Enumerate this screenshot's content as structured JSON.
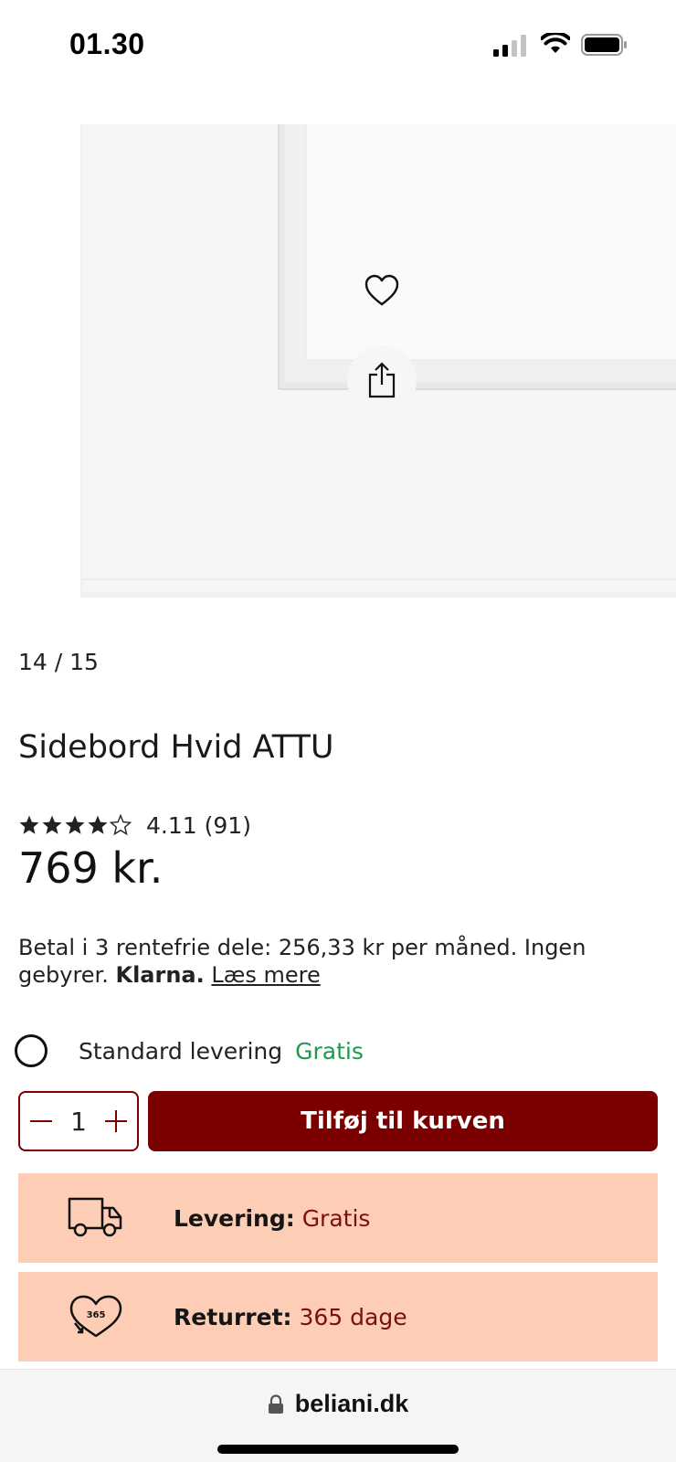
{
  "status": {
    "time": "01.30"
  },
  "gallery": {
    "counter": "14 / 15"
  },
  "product": {
    "title": "Sidebord Hvid ATTU",
    "rating_value": "4.11",
    "rating_count": "(91)",
    "stars_filled": 4,
    "stars_total": 5,
    "price": "769 kr."
  },
  "klarna": {
    "text": "Betal i 3 rentefrie dele: 256,33 kr per måned. Ingen gebyrer.",
    "brand": "Klarna.",
    "link": "Læs mere"
  },
  "delivery_option": {
    "label": "Standard levering",
    "price": "Gratis"
  },
  "cart": {
    "quantity": "1",
    "button": "Tilføj til kurven"
  },
  "info": {
    "delivery_key": "Levering:",
    "delivery_value": "Gratis",
    "return_key": "Returret:",
    "return_value": "365 dage",
    "return_badge": "365"
  },
  "browser": {
    "url": "beliani.dk"
  },
  "colors": {
    "accent": "#7a0000",
    "info_bg": "#fdcdb6",
    "free_green": "#1e9a4a"
  }
}
